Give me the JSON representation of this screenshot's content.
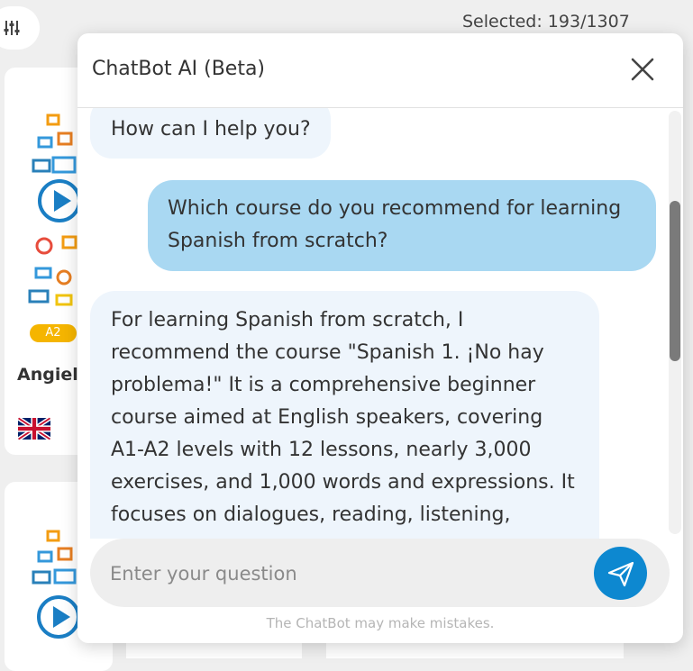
{
  "background": {
    "selected_text": "Selected: 193/1307",
    "card1": {
      "level": "A2",
      "title": "Angiel"
    }
  },
  "chat": {
    "title": "ChatBot AI (Beta)",
    "messages": [
      {
        "role": "bot",
        "text": "How can I help you?"
      },
      {
        "role": "user",
        "text": "Which course do you recommend for learning Spanish from scratch?"
      },
      {
        "role": "bot",
        "text": "For learning Spanish from scratch, I recommend the course \"Spanish 1. ¡No hay problema!\" It is a comprehensive beginner course aimed at English speakers, covering A1-A2 levels with 12 lessons, nearly 3,000 exercises, and 1,000 words and expressions. It focuses on dialogues, reading, listening,"
      }
    ],
    "input_placeholder": "Enter your question",
    "disclaimer": "The ChatBot may make mistakes."
  },
  "colors": {
    "accent": "#0d88d0",
    "user_bubble": "#a9d8f2",
    "bot_bubble": "#eef5fc",
    "level_badge": "#f5b500"
  },
  "icons": [
    "filter-sliders-icon",
    "close-icon",
    "send-icon",
    "play-icon",
    "uk-flag-icon"
  ]
}
